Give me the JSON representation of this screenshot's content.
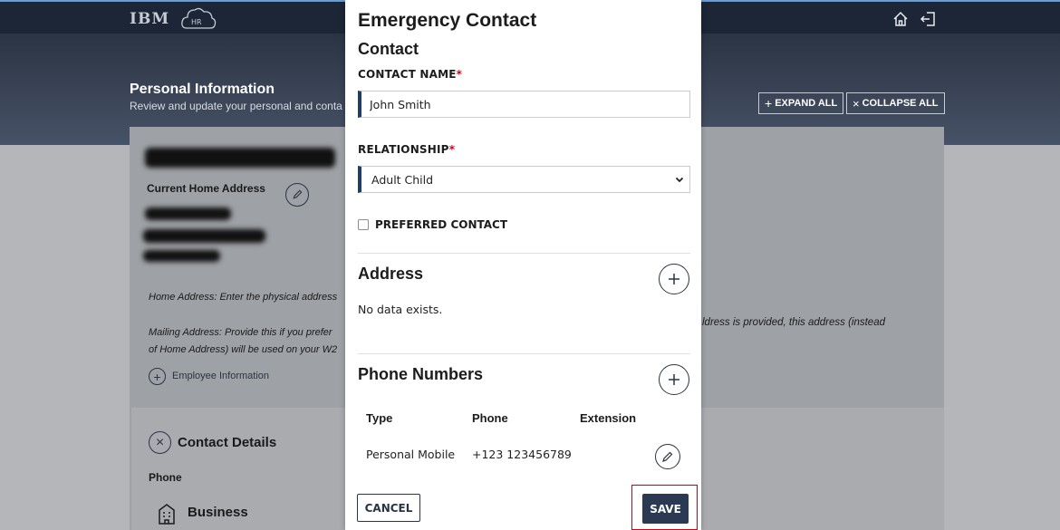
{
  "topbar": {
    "logo_text": "IBM",
    "icons": [
      "hr-cloud-icon",
      "home-icon",
      "logout-icon"
    ]
  },
  "banner": {
    "title": "Personal Information",
    "subtitle": "Review and update your personal and conta",
    "expand_all": "EXPAND ALL",
    "collapse_all": "COLLAPSE ALL"
  },
  "background": {
    "name_redacted": "Amanda M Mac Evitt",
    "current_home_address": "Current Home Address",
    "home_address_note": "Home Address: Enter the physical address",
    "mailing_note_1": "Mailing Address: Provide this if you prefer",
    "mailing_note_2": "of Home Address) will be used on your W2",
    "mailing_note_right": "ldress is provided, this address (instead",
    "employee_info": "Employee Information",
    "contact_details": "Contact Details",
    "phone": "Phone",
    "business": "Business"
  },
  "modal": {
    "title": "Emergency Contact",
    "subtitle": "Contact",
    "contact_name_label": "CONTACT NAME",
    "contact_name_value": "John Smith",
    "relationship_label": "RELATIONSHIP",
    "relationship_value": "Adult Child",
    "required_mark": "*",
    "preferred_contact_label": "PREFERRED CONTACT",
    "address_title": "Address",
    "address_empty": "No data exists.",
    "phone_title": "Phone Numbers",
    "phone_table": {
      "headers": [
        "Type",
        "Phone",
        "Extension"
      ],
      "rows": [
        {
          "type": "Personal Mobile",
          "phone": "+123 123456789",
          "extension": ""
        }
      ]
    },
    "cancel_label": "CANCEL",
    "save_label": "SAVE"
  },
  "colors": {
    "navy": "#2b3a52",
    "accent_border": "#1f3d6b",
    "required": "#d0021b",
    "highlight": "#d0021b"
  }
}
